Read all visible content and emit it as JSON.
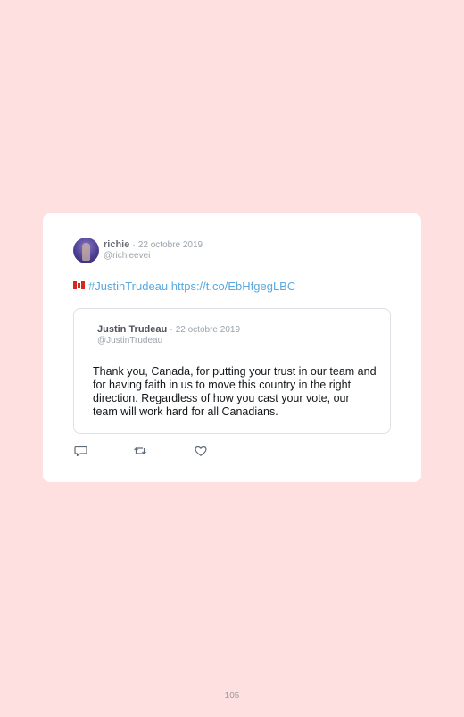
{
  "tweet": {
    "author": {
      "name": "richie",
      "handle": "@richieevei",
      "date": "22 octobre 2019",
      "separator": "·"
    },
    "flag_emoji": "canada-flag-icon",
    "hashtag": "#JustinTrudeau",
    "link": "https://t.co/EbHfgegLBC",
    "quoted": {
      "name": "Justin Trudeau",
      "handle": "@JustinTrudeau",
      "date": "22 octobre 2019",
      "separator": "·",
      "text": "Thank you, Canada, for putting your trust in our team and for having faith in us to move this country in the right direction. Regardless of how you cast your vote, our team will work hard for all Canadians."
    },
    "actions": {
      "reply_icon": "reply-icon",
      "retweet_icon": "retweet-icon",
      "like_icon": "heart-icon"
    }
  },
  "page": {
    "number": "105"
  },
  "colors": {
    "background": "#ffe0e1",
    "card": "#ffffff",
    "link": "#5aa8e0",
    "muted": "#9aa3ad"
  }
}
